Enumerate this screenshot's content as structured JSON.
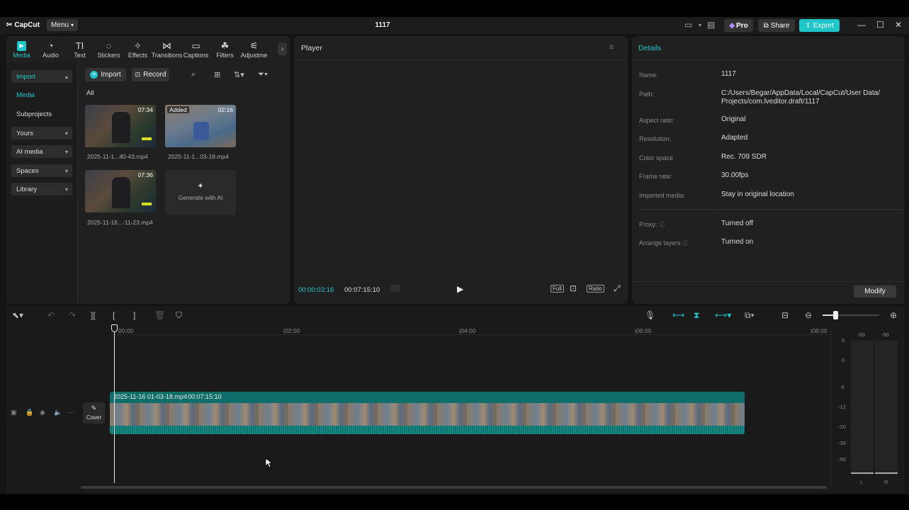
{
  "app": {
    "logo_text": "CapCut",
    "menu_label": "Menu",
    "project_title": "1117"
  },
  "title_actions": {
    "pro_label": "Pro",
    "share_label": "Share",
    "export_label": "Export"
  },
  "toolbar": {
    "tools": [
      {
        "label": "Media",
        "icon": "media-icon",
        "glyph": "▶",
        "active": true
      },
      {
        "label": "Audio",
        "icon": "audio-icon",
        "glyph": "◔"
      },
      {
        "label": "Text",
        "icon": "text-icon",
        "glyph": "TI"
      },
      {
        "label": "Stickers",
        "icon": "stickers-icon",
        "glyph": "◌"
      },
      {
        "label": "Effects",
        "icon": "effects-icon",
        "glyph": "✧"
      },
      {
        "label": "Transitions",
        "icon": "transitions-icon",
        "glyph": "⋈"
      },
      {
        "label": "Captions",
        "icon": "captions-icon",
        "glyph": "▭"
      },
      {
        "label": "Filters",
        "icon": "filters-icon",
        "glyph": "☘"
      },
      {
        "label": "Adjustme",
        "icon": "adjustments-icon",
        "glyph": "⚟"
      }
    ]
  },
  "sidebar": {
    "import_label": "Import",
    "media_label": "Media",
    "subprojects_label": "Subprojects",
    "yours_label": "Yours",
    "ai_media_label": "AI media",
    "spaces_label": "Spaces",
    "library_label": "Library"
  },
  "media": {
    "import_button": "Import",
    "record_button": "Record",
    "filter_all": "All",
    "items": [
      {
        "name": "2025-11-1...40-43.mp4",
        "duration": "07:34",
        "tag": ""
      },
      {
        "name": "2025-11-1...03-18.mp4",
        "duration": "02:16",
        "tag": "Added"
      },
      {
        "name": "2025-11-16...-11-23.mp4",
        "duration": "07:36",
        "tag": ""
      }
    ],
    "generate_label": "Generate with AI"
  },
  "player": {
    "title": "Player",
    "current_time": "00:00:03:16",
    "total_time": "00:07:15:10",
    "full_label": "Full",
    "ratio_label": "Ratio"
  },
  "details": {
    "title": "Details",
    "rows": [
      {
        "label": "Name:",
        "value": "1117"
      },
      {
        "label": "Path:",
        "value": "C:/Users/Begar/AppData/Local/CapCut/User Data/",
        "value2": "Projects/com.lveditor.draft/1117"
      },
      {
        "label": "Aspect ratio:",
        "value": "Original"
      },
      {
        "label": "Resolution:",
        "value": "Adapted"
      },
      {
        "label": "Color space",
        "value": "Rec. 709 SDR"
      },
      {
        "label": "Frame rate:",
        "value": "30.00fps"
      },
      {
        "label": "Imported media:",
        "value": "Stay in original location"
      },
      {
        "label": "Proxy:",
        "value": "Turned off"
      },
      {
        "label": "Arrange layers",
        "value": "Turned on"
      }
    ],
    "modify_button": "Modify"
  },
  "timeline": {
    "ruler": [
      "00:00",
      "|02:00",
      "|04:00",
      "|06:00",
      "|08:00"
    ],
    "clip_name": "2025-11-16 01-03-18.mp4",
    "clip_duration": "00:07:15:10",
    "cover_label": "Cover"
  },
  "meter": {
    "scale": [
      "6",
      "0",
      "-6",
      "-12",
      "-20",
      "-30",
      "-50"
    ],
    "left_label": "L",
    "right_label": "R",
    "top_label_l": "-00",
    "top_label_r": "-50"
  },
  "colors": {
    "accent": "#1fc6c9",
    "clip": "#0f6e6a",
    "panel": "#202020"
  }
}
